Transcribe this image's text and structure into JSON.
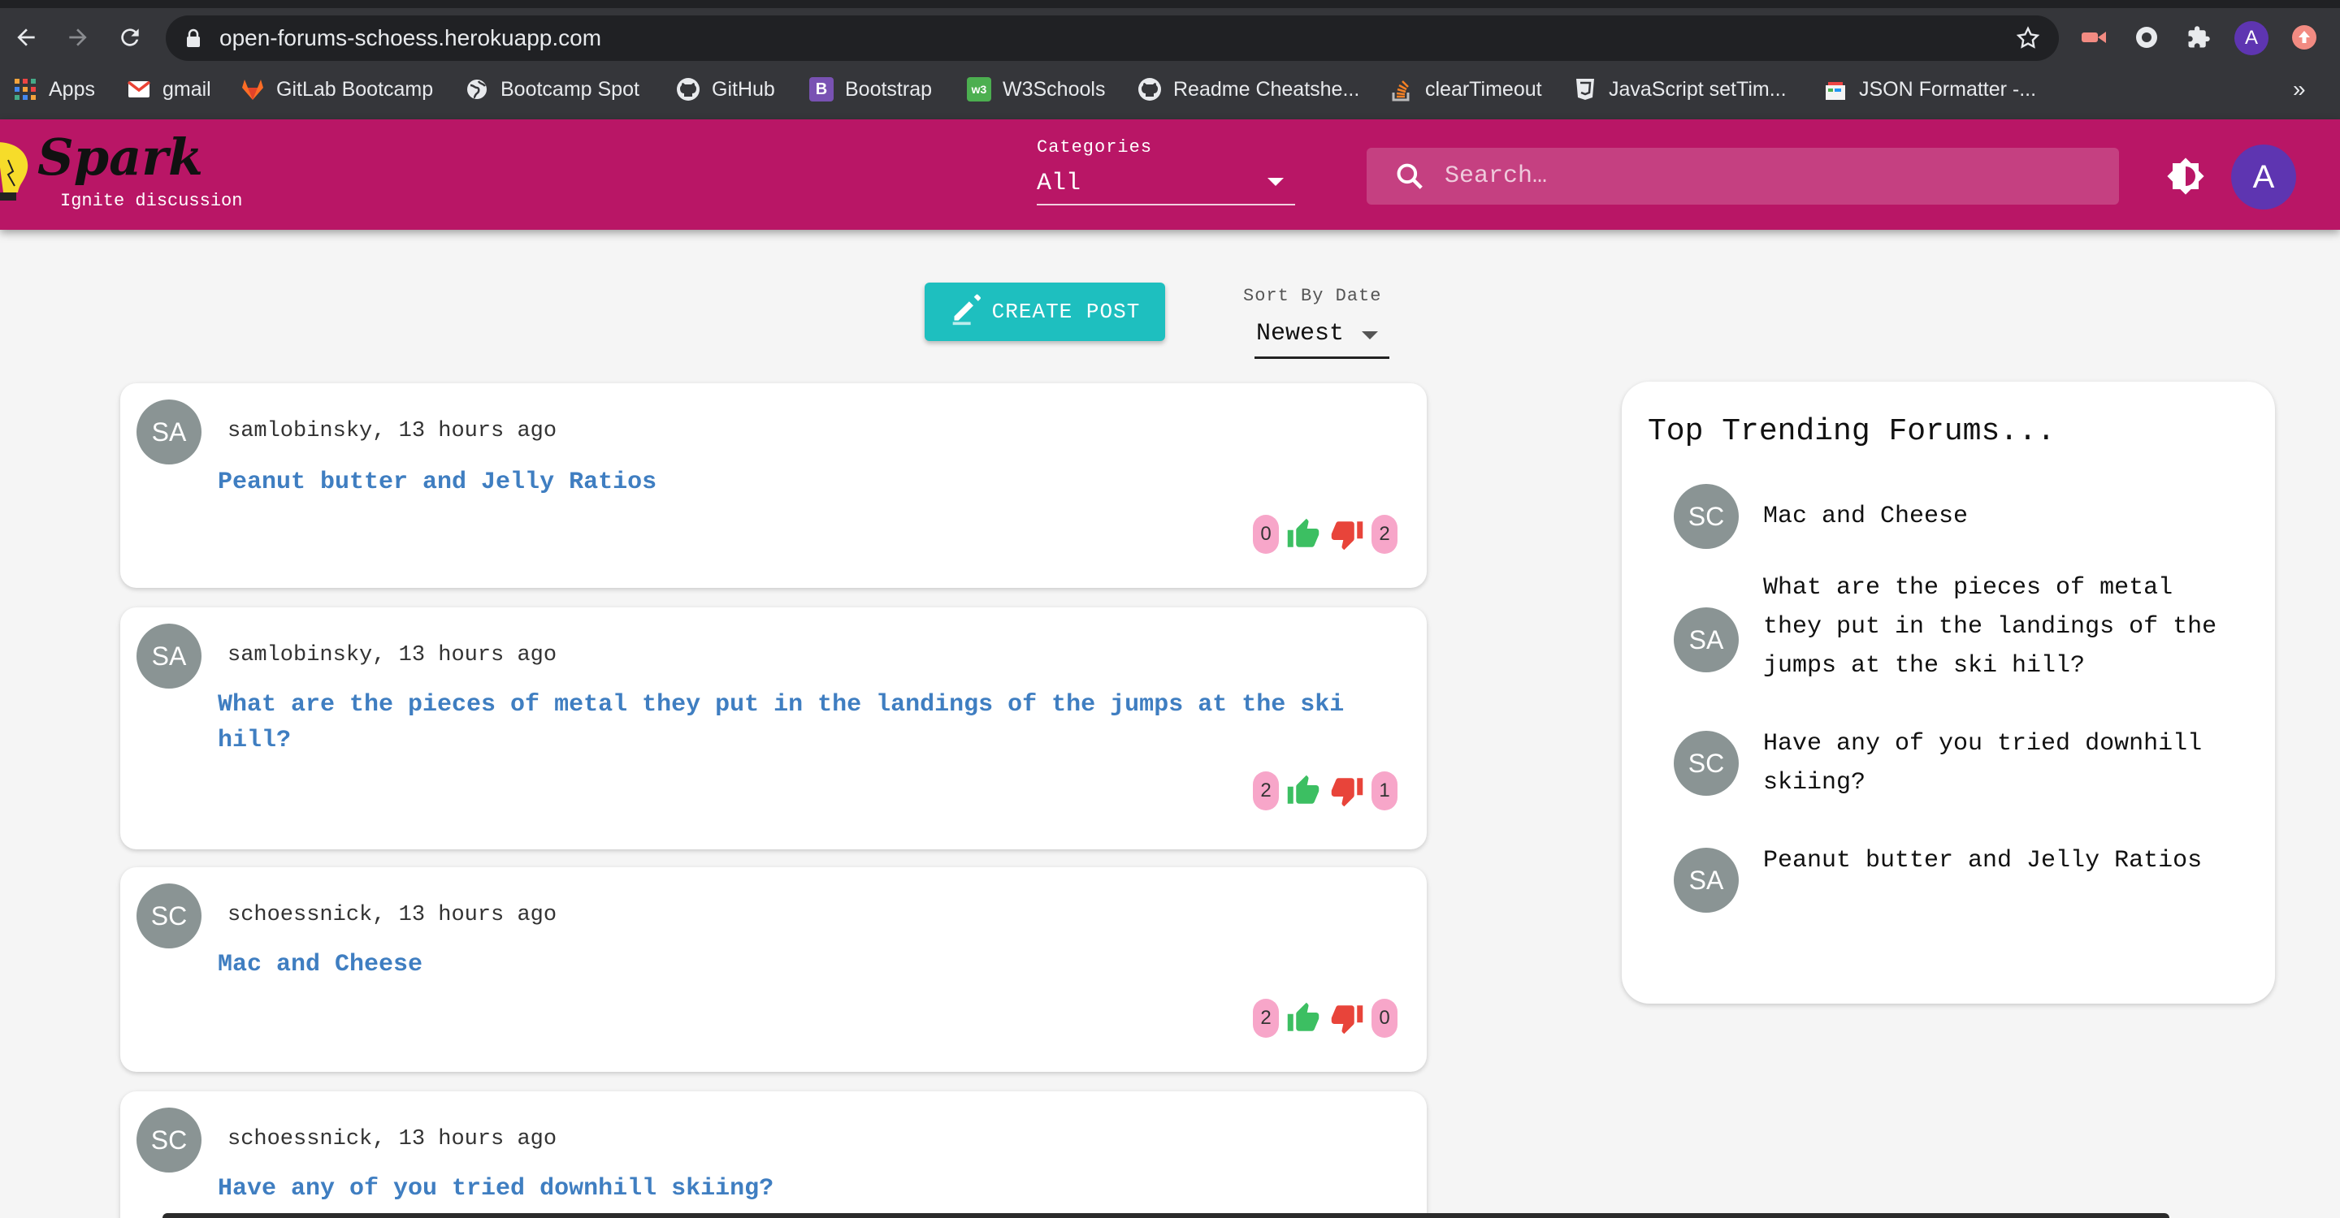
{
  "browser": {
    "url": "open-forums-schoess.herokuapp.com",
    "profile_initial": "A",
    "bookmarks": [
      {
        "label": "Apps",
        "icon": "apps-grid-icon"
      },
      {
        "label": "gmail",
        "icon": "gmail-icon"
      },
      {
        "label": "GitLab Bootcamp",
        "icon": "gitlab-icon"
      },
      {
        "label": "Bootcamp Spot",
        "icon": "globe-icon"
      },
      {
        "label": "GitHub",
        "icon": "github-icon"
      },
      {
        "label": "Bootstrap",
        "icon": "bootstrap-icon"
      },
      {
        "label": "W3Schools",
        "icon": "w3schools-icon"
      },
      {
        "label": "Readme Cheatshe...",
        "icon": "github-icon"
      },
      {
        "label": "clearTimeout",
        "icon": "stackoverflow-icon"
      },
      {
        "label": "JavaScript setTim...",
        "icon": "html5-icon"
      },
      {
        "label": "JSON Formatter -...",
        "icon": "json-formatter-icon"
      }
    ],
    "overflow": "»"
  },
  "app": {
    "logo": "Spark",
    "tagline": "Ignite discussion",
    "categories_label": "Categories",
    "categories_value": "All",
    "search_placeholder": "Search…",
    "user_initial": "A",
    "colors": {
      "appbar": "#b91666",
      "accent": "#1ebfbf",
      "title_link": "#3f7ec1",
      "vote_badge": "#f7a6c9",
      "thumb_up": "#3cbf62",
      "thumb_down": "#e8443a"
    }
  },
  "controls": {
    "create_post": "CREATE POST",
    "sort_label": "Sort By Date",
    "sort_value": "Newest"
  },
  "posts": [
    {
      "initials": "SA",
      "meta": "samlobinsky, 13 hours ago",
      "title": "Peanut butter and Jelly Ratios",
      "likes": "0",
      "dislikes": "2"
    },
    {
      "initials": "SA",
      "meta": "samlobinsky, 13 hours ago",
      "title": "What are the pieces of metal they put in the landings of the jumps at the ski hill?",
      "likes": "2",
      "dislikes": "1"
    },
    {
      "initials": "SC",
      "meta": "schoessnick, 13 hours ago",
      "title": "Mac and Cheese",
      "likes": "2",
      "dislikes": "0"
    },
    {
      "initials": "SC",
      "meta": "schoessnick, 13 hours ago",
      "title": "Have any of you tried downhill skiing?"
    }
  ],
  "trending": {
    "title": "Top Trending Forums...",
    "items": [
      {
        "initials": "SC",
        "title": "Mac and Cheese"
      },
      {
        "initials": "SA",
        "title": "What are the pieces of metal they put in the landings of the jumps at the ski hill?"
      },
      {
        "initials": "SC",
        "title": "Have any of you tried downhill skiing?"
      },
      {
        "initials": "SA",
        "title": "Peanut butter and Jelly Ratios"
      }
    ]
  }
}
